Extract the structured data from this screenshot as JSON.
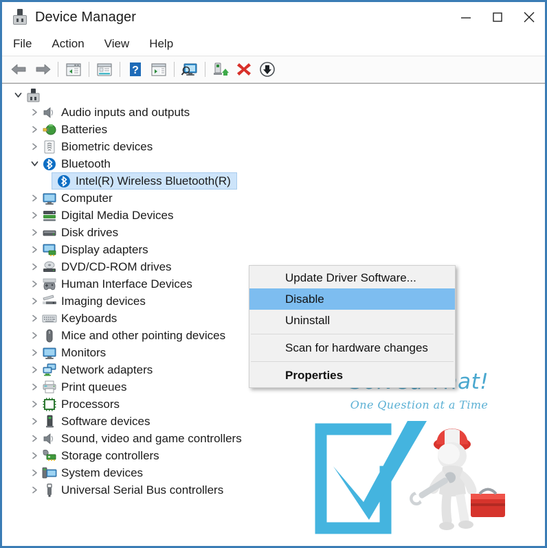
{
  "window": {
    "title": "Device Manager",
    "icon": "device-plug-icon",
    "border_color": "#3b7cb5",
    "controls": [
      {
        "name": "minimize",
        "glyph": "minimize-icon"
      },
      {
        "name": "maximize",
        "glyph": "maximize-icon"
      },
      {
        "name": "close",
        "glyph": "close-icon"
      }
    ]
  },
  "menubar": {
    "items": [
      {
        "label": "File"
      },
      {
        "label": "Action"
      },
      {
        "label": "View"
      },
      {
        "label": "Help"
      }
    ]
  },
  "toolbar": {
    "buttons": [
      {
        "name": "back-button",
        "icon": "back-arrow-icon"
      },
      {
        "name": "forward-button",
        "icon": "forward-arrow-icon"
      },
      {
        "name": "show-hide-console-tree-button",
        "icon": "console-tree-icon"
      },
      {
        "name": "properties-button",
        "icon": "properties-window-icon"
      },
      {
        "name": "help-button",
        "icon": "question-mark-icon"
      },
      {
        "name": "show-hide-action-pane-button",
        "icon": "action-pane-icon"
      },
      {
        "name": "scan-hardware-changes-button",
        "icon": "monitor-scan-icon"
      },
      {
        "name": "update-driver-button",
        "icon": "update-driver-icon"
      },
      {
        "name": "uninstall-device-button",
        "icon": "red-x-icon"
      },
      {
        "name": "disable-device-button",
        "icon": "down-arrow-circle-icon"
      }
    ]
  },
  "tree": {
    "root": {
      "label": "",
      "icon": "computer-root-icon",
      "expanded": true
    },
    "items": [
      {
        "label": "Audio inputs and outputs",
        "icon": "speaker-icon",
        "expanded": false,
        "level": 1
      },
      {
        "label": "Batteries",
        "icon": "battery-plug-icon",
        "expanded": false,
        "level": 1
      },
      {
        "label": "Biometric devices",
        "icon": "fingerprint-icon",
        "expanded": false,
        "level": 1
      },
      {
        "label": "Bluetooth",
        "icon": "bluetooth-icon",
        "expanded": true,
        "level": 1
      },
      {
        "label": "Intel(R) Wireless Bluetooth(R)",
        "icon": "bluetooth-icon",
        "expanded": null,
        "level": 2,
        "selected": true
      },
      {
        "label": "Computer",
        "icon": "monitor-icon",
        "expanded": false,
        "level": 1
      },
      {
        "label": "Digital Media Devices",
        "icon": "media-device-icon",
        "expanded": false,
        "level": 1
      },
      {
        "label": "Disk drives",
        "icon": "disk-drive-icon",
        "expanded": false,
        "level": 1
      },
      {
        "label": "Display adapters",
        "icon": "display-adapter-icon",
        "expanded": false,
        "level": 1
      },
      {
        "label": "DVD/CD-ROM drives",
        "icon": "optical-drive-icon",
        "expanded": false,
        "level": 1
      },
      {
        "label": "Human Interface Devices",
        "icon": "gamepad-icon",
        "expanded": false,
        "level": 1
      },
      {
        "label": "Imaging devices",
        "icon": "scanner-icon",
        "expanded": false,
        "level": 1
      },
      {
        "label": "Keyboards",
        "icon": "keyboard-icon",
        "expanded": false,
        "level": 1
      },
      {
        "label": "Mice and other pointing devices",
        "icon": "mouse-icon",
        "expanded": false,
        "level": 1
      },
      {
        "label": "Monitors",
        "icon": "monitor-icon",
        "expanded": false,
        "level": 1
      },
      {
        "label": "Network adapters",
        "icon": "network-adapter-icon",
        "expanded": false,
        "level": 1
      },
      {
        "label": "Print queues",
        "icon": "printer-icon",
        "expanded": false,
        "level": 1
      },
      {
        "label": "Processors",
        "icon": "processor-icon",
        "expanded": false,
        "level": 1
      },
      {
        "label": "Software devices",
        "icon": "software-device-icon",
        "expanded": false,
        "level": 1
      },
      {
        "label": "Sound, video and game controllers",
        "icon": "speaker-icon",
        "expanded": false,
        "level": 1
      },
      {
        "label": "Storage controllers",
        "icon": "storage-controller-icon",
        "expanded": false,
        "level": 1
      },
      {
        "label": "System devices",
        "icon": "system-device-icon",
        "expanded": false,
        "level": 1
      },
      {
        "label": "Universal Serial Bus controllers",
        "icon": "usb-icon",
        "expanded": false,
        "level": 1
      }
    ],
    "selection_color": "#cde4fa"
  },
  "context_menu": {
    "highlight_color": "#7dbdf0",
    "items": [
      {
        "type": "item",
        "label": "Update Driver Software...",
        "highlighted": false,
        "bold": false
      },
      {
        "type": "item",
        "label": "Disable",
        "highlighted": true,
        "bold": false
      },
      {
        "type": "item",
        "label": "Uninstall",
        "highlighted": false,
        "bold": false
      },
      {
        "type": "separator"
      },
      {
        "type": "item",
        "label": "Scan for hardware changes",
        "highlighted": false,
        "bold": false
      },
      {
        "type": "separator"
      },
      {
        "type": "item",
        "label": "Properties",
        "highlighted": false,
        "bold": true
      }
    ]
  },
  "watermark": {
    "title": "Solved That!",
    "subtitle": "One Question at a Time",
    "brand_color": "#4ba8cf",
    "art": "blue-checkbox-with-repairman-figure"
  }
}
